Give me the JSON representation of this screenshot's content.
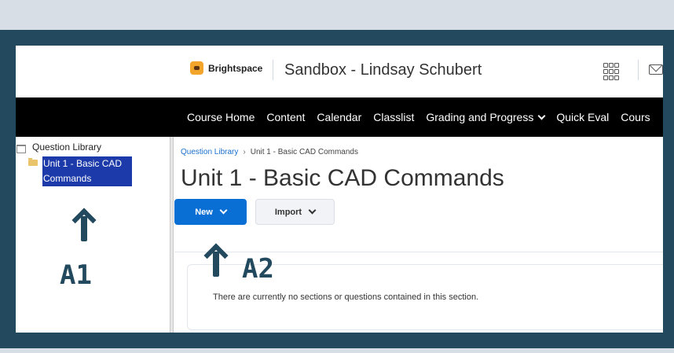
{
  "header": {
    "brand": "Brightspace",
    "course_title": "Sandbox - Lindsay Schubert"
  },
  "nav": {
    "items": [
      "Course Home",
      "Content",
      "Calendar",
      "Classlist",
      "Grading and Progress",
      "Quick Eval",
      "Cours"
    ]
  },
  "tree": {
    "root_label": "Question Library",
    "child_line1": "Unit 1 - Basic CAD",
    "child_line2": "Commands"
  },
  "breadcrumb": {
    "link": "Question Library",
    "current": "Unit 1 - Basic CAD Commands"
  },
  "page_title": "Unit 1 - Basic CAD Commands",
  "buttons": {
    "new_label": "New",
    "import_label": "Import"
  },
  "empty_message": "There are currently no sections or questions contained in this section.",
  "callouts": {
    "a1": "A1",
    "a2": "A2"
  },
  "colors": {
    "frame": "#23495e",
    "primary_button": "#0a6fd4",
    "selection": "#1c3aa9",
    "navbar": "#000000"
  }
}
